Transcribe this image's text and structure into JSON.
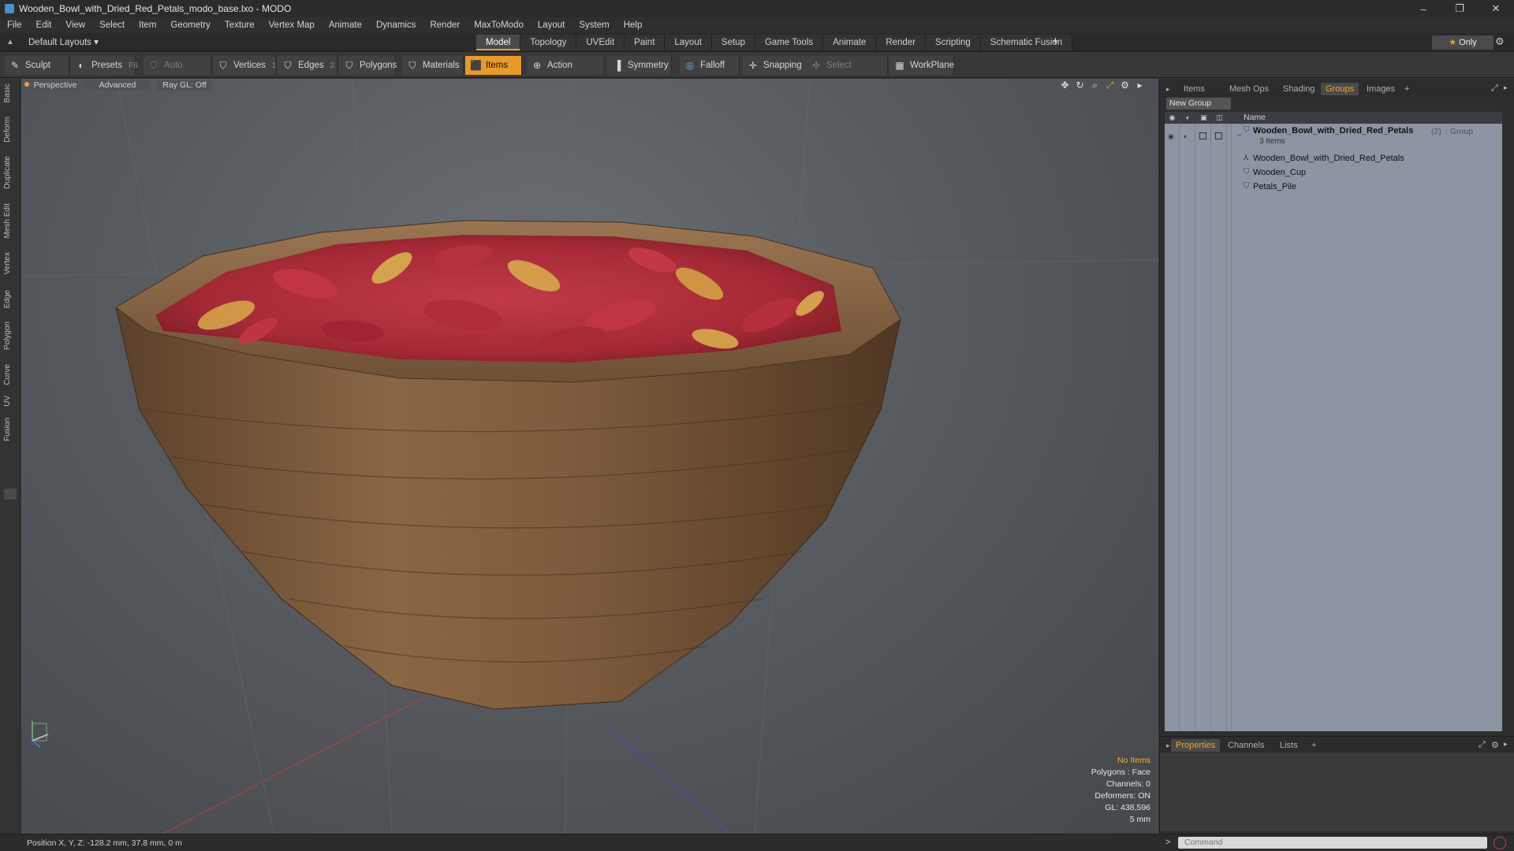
{
  "window": {
    "title": "Wooden_Bowl_with_Dried_Red_Petals_modo_base.lxo - MODO",
    "controls": [
      "–",
      "❐",
      "✕"
    ]
  },
  "menu": [
    "File",
    "Edit",
    "View",
    "Select",
    "Item",
    "Geometry",
    "Texture",
    "Vertex Map",
    "Animate",
    "Dynamics",
    "Render",
    "MaxToModo",
    "Layout",
    "System",
    "Help"
  ],
  "layout_bar": {
    "layout_selector": "Default Layouts ▾",
    "tabs": [
      "Model",
      "Topology",
      "UVEdit",
      "Paint",
      "Layout",
      "Setup",
      "Game Tools",
      "Animate",
      "Render",
      "Scripting",
      "Schematic Fusion"
    ],
    "active_tab": "Model",
    "add": "+",
    "only_label": "Only"
  },
  "toolbar": {
    "sculpt": "Sculpt",
    "presets": "Presets",
    "presets_key": "F6",
    "auto_select": "Auto Select",
    "vertices": "Vertices",
    "vertices_key": "1",
    "edges": "Edges",
    "edges_key": "2",
    "polygons": "Polygons",
    "materials": "Materials",
    "items": "Items",
    "action_center": "Action Center",
    "symmetry": "Symmetry",
    "falloff": "Falloff",
    "snapping": "Snapping",
    "select_through": "Select Through",
    "workplane": "WorkPlane"
  },
  "left_tabs": [
    "Basic",
    "Deform",
    "Duplicate",
    "Mesh Edit",
    "Vertex",
    "Edge",
    "Polygon",
    "Curve",
    "UV",
    "Fusion"
  ],
  "viewport": {
    "view": "Perspective",
    "mode": "Advanced",
    "raygl": "Ray GL: Off",
    "info": {
      "no_items": "No Items",
      "polygons": "Polygons : Face",
      "channels": "Channels: 0",
      "deformers": "Deformers: ON",
      "gl": "GL: 438,596",
      "scale": "5 mm"
    }
  },
  "right_panel": {
    "tabs": [
      "Items",
      "Mesh Ops",
      "Shading",
      "Groups",
      "Images"
    ],
    "active_tab": "Groups",
    "add": "+",
    "new_group": "New Group",
    "name_header": "Name",
    "group": {
      "name": "Wooden_Bowl_with_Dried_Red_Petals",
      "count": "(2)",
      "type": ": Group",
      "items_count": "3 Items"
    },
    "children": [
      "Wooden_Bowl_with_Dried_Red_Petals",
      "Wooden_Cup",
      "Petals_Pile"
    ],
    "bottom_tabs": [
      "Properties",
      "Channels",
      "Lists"
    ],
    "bottom_active": "Properties"
  },
  "statusbar": {
    "position": "Position X, Y, Z:  -128.2 mm, 37.8 mm, 0 m",
    "command_placeholder": "Command"
  },
  "colors": {
    "accent": "#f0a030",
    "bowl": "#7a5a3c",
    "petal": "#b8323e"
  }
}
